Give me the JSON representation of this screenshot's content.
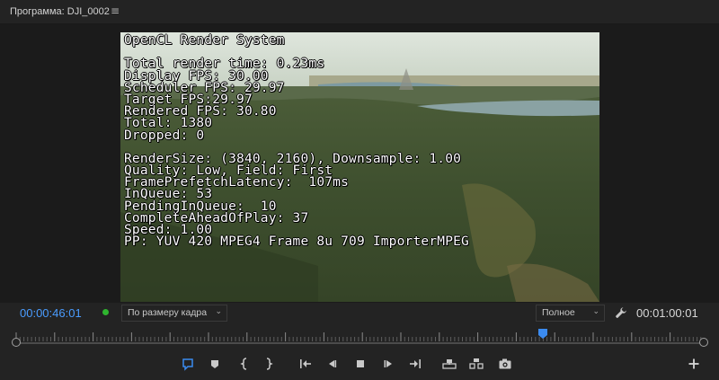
{
  "panel": {
    "title": "Программа: DJI_0002",
    "menu_icon": "hamburger-menu-icon"
  },
  "video": {
    "overlay_lines": [
      "OpenCL Render System",
      "",
      "Total render time: 0.23ms",
      "Display FPS: 30.00",
      "Scheduler FPS: 29.97",
      "Target FPS:29.97",
      "Rendered FPS: 30.80",
      "Total: 1380",
      "Dropped: 0",
      "",
      "RenderSize: (3840, 2160), Downsample: 1.00",
      "Quality: Low, Field: First",
      "FramePrefetchLatency:  107ms",
      "InQueue: 53",
      "PendingInQueue:  10",
      "CompleteAheadOfPlay: 37",
      "Speed: 1.00",
      "PP: YUV 420 MPEG4 Frame 8u 709 ImporterMPEG"
    ]
  },
  "controls": {
    "current_timecode": "00:00:46:01",
    "zoom_select": "По размеру кадра",
    "quality_select": "Полное",
    "duration_timecode": "00:01:00:01"
  },
  "colors": {
    "timecode_blue": "#4a9cff",
    "playhead_blue": "#3b8bf0",
    "indicator_green": "#2fb52f"
  },
  "transport_icons": [
    "add-marker-icon",
    "marker-icon",
    "mark-in-icon",
    "mark-out-icon",
    "go-to-in-icon",
    "step-back-icon",
    "stop-icon",
    "step-forward-icon",
    "go-to-out-icon",
    "lift-icon",
    "extract-icon",
    "export-frame-icon",
    "add-button-icon"
  ]
}
